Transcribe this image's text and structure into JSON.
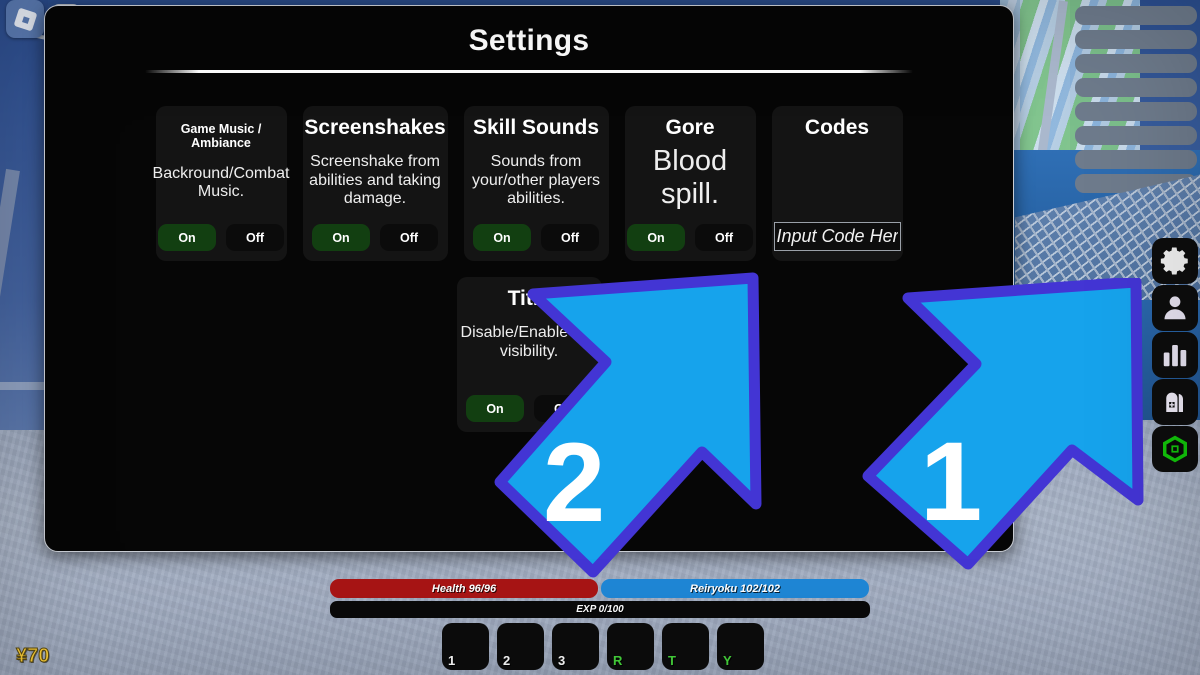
{
  "game": {
    "currency": "¥70",
    "top_left_icons": [
      "roblox-logo",
      "menu-list"
    ]
  },
  "settings_panel": {
    "title": "Settings",
    "cards": [
      {
        "title": "Game Music / Ambiance",
        "title_size": "small",
        "desc": "Backround/Combat Music.",
        "desc_size": "normal",
        "control": "toggle",
        "on_label": "On",
        "off_label": "Off",
        "selected": "On"
      },
      {
        "title": "Screenshakes",
        "title_size": "normal",
        "desc": "Screenshake from abilities and taking damage.",
        "desc_size": "normal",
        "control": "toggle",
        "on_label": "On",
        "off_label": "Off",
        "selected": "On"
      },
      {
        "title": "Skill Sounds",
        "title_size": "normal",
        "desc": "Sounds from your/other players abilities.",
        "desc_size": "normal",
        "control": "toggle",
        "on_label": "On",
        "off_label": "Off",
        "selected": "On"
      },
      {
        "title": "Gore",
        "title_size": "normal",
        "desc": "Blood spill.",
        "desc_size": "big",
        "control": "toggle",
        "on_label": "On",
        "off_label": "Off",
        "selected": "On"
      },
      {
        "title": "Codes",
        "title_size": "normal",
        "desc": "",
        "desc_size": "normal",
        "control": "input",
        "input_placeholder": "Input Code Here",
        "input_value": ""
      }
    ],
    "second_row": [
      {
        "title": "Title",
        "desc": "Disable/Enable title visibility.",
        "control": "toggle",
        "on_label": "On",
        "off_label": "Off",
        "selected": "On"
      }
    ]
  },
  "annotations": [
    {
      "number": "1",
      "points_to": "settings-gear-icon",
      "fill": "#16a3ec",
      "stroke": "#4335d4"
    },
    {
      "number": "2",
      "points_to": "settings-panel",
      "fill": "#16a3ec",
      "stroke": "#4335d4"
    }
  ],
  "hud": {
    "health": "Health 96/96",
    "reiryoku": "Reiryoku 102/102",
    "exp": "EXP 0/100",
    "slots": [
      {
        "key": "1",
        "type": "number"
      },
      {
        "key": "2",
        "type": "number"
      },
      {
        "key": "3",
        "type": "number"
      },
      {
        "key": "R",
        "type": "key"
      },
      {
        "key": "T",
        "type": "key"
      },
      {
        "key": "Y",
        "type": "key"
      }
    ]
  },
  "rail": {
    "items": [
      {
        "name": "settings-gear-icon",
        "label": "Settings"
      },
      {
        "name": "character-icon",
        "label": "Character"
      },
      {
        "name": "stats-icon",
        "label": "Stats"
      },
      {
        "name": "backpack-icon",
        "label": "Inventory"
      },
      {
        "name": "roblox-logo-icon",
        "label": "Roblox"
      }
    ]
  },
  "colors": {
    "accent_blue": "#16a3ec",
    "accent_purple": "#4335d4",
    "toggle_on": "#123f11",
    "health_bar": "#a81515",
    "reiryoku_bar": "#1f87d6",
    "currency_gold": "#ffd23a"
  }
}
